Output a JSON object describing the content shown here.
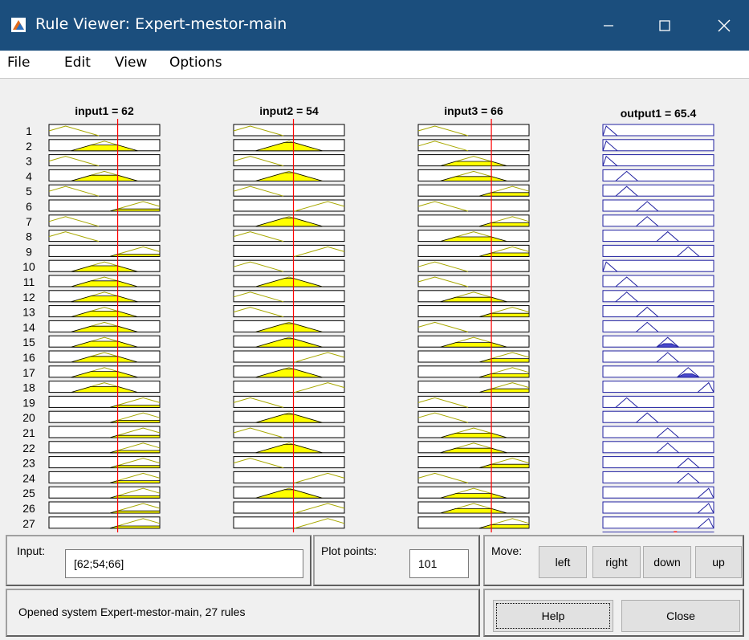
{
  "window": {
    "title": "Rule Viewer: Expert-mestor-main"
  },
  "menu": [
    {
      "label": "File"
    },
    {
      "label": "Edit"
    },
    {
      "label": "View"
    },
    {
      "label": "Options"
    }
  ],
  "plot": {
    "columns": [
      {
        "title": "input1 = 62",
        "value": 62,
        "range": [
          0,
          100
        ]
      },
      {
        "title": "input2 = 54",
        "value": 54,
        "range": [
          0,
          100
        ]
      },
      {
        "title": "input3 = 66",
        "value": 66,
        "range": [
          0,
          100
        ]
      },
      {
        "title": "output1 = 65.4",
        "value": 65.4,
        "range": [
          0,
          100
        ]
      }
    ],
    "rule_numbers": [
      "1",
      "2",
      "3",
      "4",
      "5",
      "6",
      "7",
      "8",
      "9",
      "10",
      "11",
      "12",
      "13",
      "14",
      "15",
      "16",
      "17",
      "18",
      "19",
      "20",
      "21",
      "22",
      "23",
      "24",
      "25",
      "26",
      "27"
    ],
    "input_terms": [
      [
        "low",
        "mid",
        "low",
        "mid",
        "low",
        "high",
        "low",
        "low",
        "high",
        "mid",
        "mid",
        "mid",
        "mid",
        "mid",
        "mid",
        "mid",
        "mid",
        "mid",
        "high",
        "high",
        "high",
        "high",
        "high",
        "high",
        "high",
        "high",
        "high"
      ],
      [
        "low",
        "mid",
        "low",
        "mid",
        "low",
        "high",
        "mid",
        "low",
        "high",
        "low",
        "mid",
        "low",
        "low",
        "mid",
        "mid",
        "high",
        "mid",
        "high",
        "low",
        "mid",
        "low",
        "mid",
        "low",
        "high",
        "mid",
        "high",
        "high"
      ],
      [
        "low",
        "low",
        "mid",
        "mid",
        "high",
        "low",
        "high",
        "mid",
        "high",
        "low",
        "low",
        "mid",
        "high",
        "low",
        "mid",
        "high",
        "high",
        "high",
        "low",
        "low",
        "mid",
        "mid",
        "high",
        "low",
        "mid",
        "mid",
        "high"
      ]
    ],
    "output_terms": [
      1,
      1,
      1,
      2,
      2,
      3,
      3,
      4,
      5,
      1,
      2,
      2,
      3,
      3,
      4,
      4,
      5,
      6,
      2,
      3,
      4,
      4,
      5,
      5,
      6,
      6,
      6
    ],
    "colors": {
      "input_outline": "#a8a800",
      "fill": "#ffff00",
      "output_line": "#2020a0",
      "output_fill": "#4a4acc",
      "marker": "#ff0000"
    }
  },
  "controls": {
    "input_label": "Input:",
    "input_value": "[62;54;66]",
    "plot_points_label": "Plot points:",
    "plot_points_value": "101",
    "move_label": "Move:",
    "left": "left",
    "right": "right",
    "down": "down",
    "up": "up",
    "help": "Help",
    "close": "Close"
  },
  "status": "Opened system Expert-mestor-main, 27 rules"
}
